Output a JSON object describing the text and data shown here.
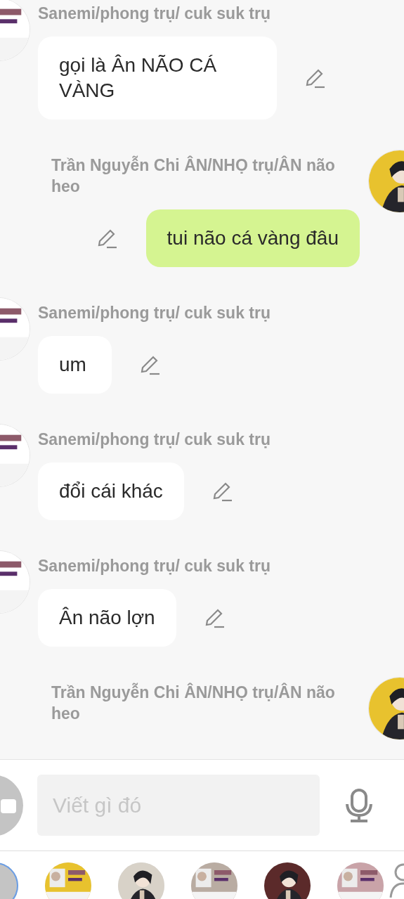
{
  "messages": [
    {
      "kind": "incoming",
      "sender": "Sanemi/phong trụ/ cuk suk trụ",
      "text": "gọi là Ân NÃO CÁ VÀNG"
    },
    {
      "kind": "outgoing",
      "sender": "Trần Nguyễn Chi ÂN/NHỌ trụ/ÂN não heo",
      "text": "tui não cá vàng đâu"
    },
    {
      "kind": "incoming",
      "sender": "Sanemi/phong trụ/ cuk suk trụ",
      "text": "um"
    },
    {
      "kind": "incoming",
      "sender": "Sanemi/phong trụ/ cuk suk trụ",
      "text": "đổi cái khác"
    },
    {
      "kind": "incoming",
      "sender": "Sanemi/phong trụ/ cuk suk trụ",
      "text": "Ân não lợn"
    },
    {
      "kind": "outgoing",
      "sender": "Trần Nguyễn Chi ÂN/NHỌ trụ/ÂN não heo"
    }
  ],
  "composer": {
    "placeholder": "Viết gì đó"
  },
  "contacts": [
    {
      "kind": "add"
    },
    {
      "kind": "picture",
      "color": "#e8c22e"
    },
    {
      "kind": "picture",
      "color": "#d8d2c8"
    },
    {
      "kind": "picture",
      "color": "#b9aca2"
    },
    {
      "kind": "picture",
      "color": "#5b2a2a"
    },
    {
      "kind": "picture",
      "color": "#c9a3a8"
    },
    {
      "kind": "person"
    }
  ]
}
